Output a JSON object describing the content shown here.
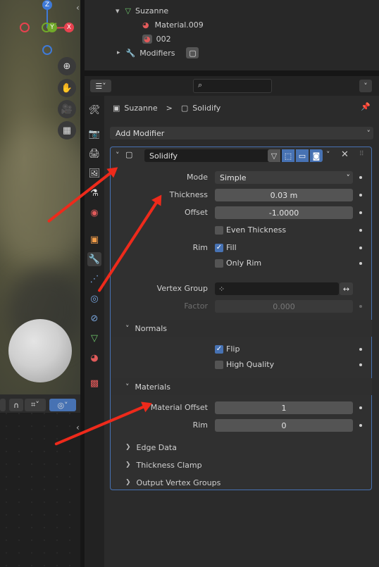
{
  "outliner": {
    "object": "Suzanne",
    "material1": "Material.009",
    "material2": "002",
    "modifiers": "Modifiers"
  },
  "props_header": {
    "breadcrumb_object": "Suzanne",
    "breadcrumb_sep": ">",
    "breadcrumb_modifier": "Solidify",
    "add_modifier": "Add Modifier"
  },
  "modifier": {
    "name": "Solidify",
    "mode_label": "Mode",
    "mode_value": "Simple",
    "thickness_label": "Thickness",
    "thickness_value": "0.03 m",
    "offset_label": "Offset",
    "offset_value": "-1.0000",
    "even_thickness": "Even Thickness",
    "even_thickness_checked": false,
    "rim_label": "Rim",
    "fill": "Fill",
    "fill_checked": true,
    "only_rim": "Only Rim",
    "only_rim_checked": false,
    "vertex_group_label": "Vertex Group",
    "vertex_group_value": "",
    "factor_label": "Factor",
    "factor_value": "0.000"
  },
  "normals": {
    "title": "Normals",
    "flip": "Flip",
    "flip_checked": true,
    "high_quality": "High Quality",
    "high_quality_checked": false
  },
  "materials": {
    "title": "Materials",
    "material_offset_label": "Material Offset",
    "material_offset_value": "1",
    "rim_label": "Rim",
    "rim_value": "0"
  },
  "collapsed_sections": [
    "Edge Data",
    "Thickness Clamp",
    "Output Vertex Groups"
  ],
  "gizmo": {
    "z": "Z",
    "y": "Y",
    "x": "X"
  },
  "colors": {
    "accent": "#4772b3",
    "annotation_arrow": "#ee2a1b",
    "x_axis": "#e8424f",
    "y_axis": "#71a92a",
    "z_axis": "#3f7ad8"
  }
}
